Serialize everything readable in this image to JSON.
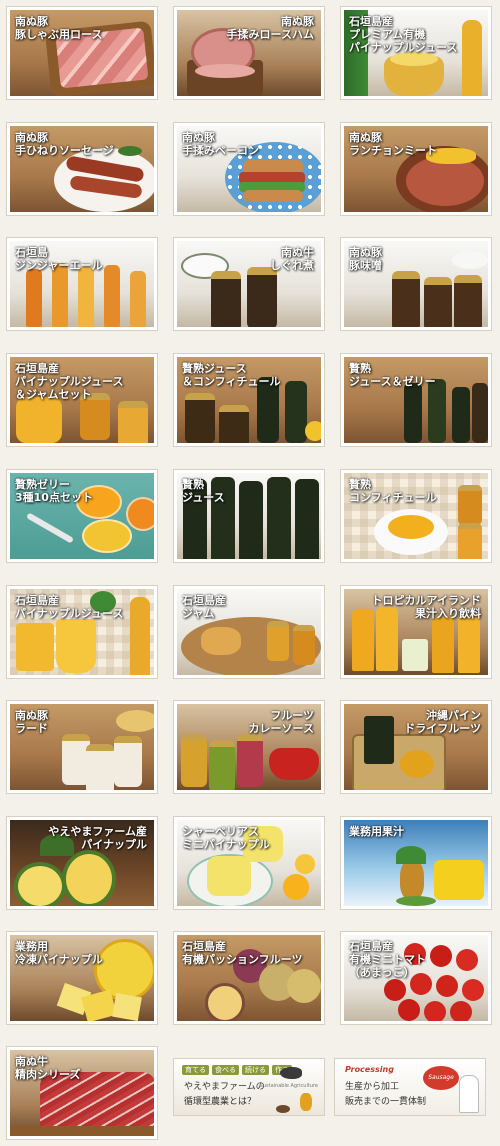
{
  "tiles": [
    {
      "label": "南ぬ豚\n豚しゃぶ用ロース",
      "align": "left"
    },
    {
      "label": "南ぬ豚\n手揉みロースハム",
      "align": "right"
    },
    {
      "label": "石垣島産\nプレミアム有機\nパイナップルジュース",
      "align": "left"
    },
    {
      "label": "南ぬ豚\n手ひねりソーセージ",
      "align": "left"
    },
    {
      "label": "南ぬ豚\n手揉みベーコン",
      "align": "left"
    },
    {
      "label": "南ぬ豚\nランチョンミート",
      "align": "left"
    },
    {
      "label": "石垣島\nジンジャーエール",
      "align": "left"
    },
    {
      "label": "南ぬ牛\nしぐれ煮",
      "align": "right"
    },
    {
      "label": "南ぬ豚\n豚味噌",
      "align": "left"
    },
    {
      "label": "石垣島産\nパイナップルジュース\n＆ジャムセット",
      "align": "left"
    },
    {
      "label": "贅熟ジュース\n＆コンフィチュール",
      "align": "left"
    },
    {
      "label": "贅熟\nジュース＆ゼリー",
      "align": "left"
    },
    {
      "label": "贅熟ゼリー\n3種10点セット",
      "align": "left"
    },
    {
      "label": "贅熟\nジュース",
      "align": "left"
    },
    {
      "label": "贅熟\nコンフィチュール",
      "align": "left"
    },
    {
      "label": "石垣島産\nパイナップルジュース",
      "align": "left"
    },
    {
      "label": "石垣島産\nジャム",
      "align": "left"
    },
    {
      "label": "トロピカルアイランド\n果汁入り飲料",
      "align": "right"
    },
    {
      "label": "南ぬ豚\nラード",
      "align": "left"
    },
    {
      "label": "フルーツ\nカレーソース",
      "align": "right"
    },
    {
      "label": "沖縄パイン\nドライフルーツ",
      "align": "right"
    },
    {
      "label": "やえやまファーム産\nパイナップル",
      "align": "right"
    },
    {
      "label": "シャーベリアス\nミニパイナップル",
      "align": "left"
    },
    {
      "label": "業務用果汁",
      "align": "left"
    },
    {
      "label": "業務用\n冷凍パイナップル",
      "align": "left"
    },
    {
      "label": "石垣島産\n有機パッションフルーツ",
      "align": "left"
    },
    {
      "label": "石垣島産\n有機ミニトマト\n（あまっこ）",
      "align": "left"
    },
    {
      "label": "南ぬ牛\n精肉シリーズ",
      "align": "left"
    }
  ],
  "banner_left": {
    "tags": [
      "育てる",
      "食べる",
      "続ける",
      "作る"
    ],
    "line1": "やえやまファームの",
    "line2": "循環型農業とは？",
    "sub": "Sustainable Agriculture",
    "color_accent": "#8a9a3a"
  },
  "banner_right": {
    "heading": "Processing",
    "line1": "生産から加工",
    "line2": "販売までの一貫体制",
    "bubble": "Sausage",
    "color_accent": "#c0392b"
  }
}
